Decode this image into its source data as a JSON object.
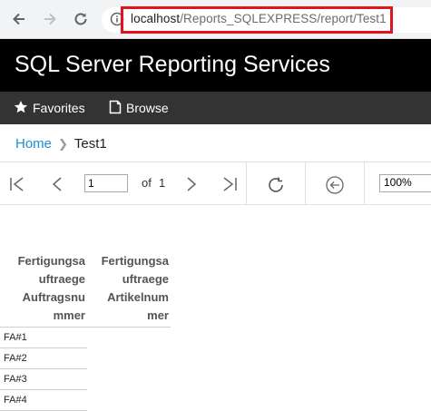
{
  "browser": {
    "url_host": "localhost",
    "url_path": "/Reports_SQLEXPRESS/report/Test1"
  },
  "header": {
    "app_title": "SQL Server Reporting Services"
  },
  "toolbar": {
    "favorites_label": "Favorites",
    "browse_label": "Browse"
  },
  "breadcrumb": {
    "home": "Home",
    "current": "Test1"
  },
  "report_toolbar": {
    "current_page": "1",
    "of_label": "of",
    "total_pages": "1",
    "zoom": "100%"
  },
  "report": {
    "columns": [
      [
        "Fertigungsa",
        "uftraege",
        "Auftragsnu",
        "mmer"
      ],
      [
        "Fertigungsa",
        "uftraege",
        "Artikelnum",
        "mer"
      ]
    ],
    "rows": [
      [
        "FA#1",
        ""
      ],
      [
        "FA#2",
        ""
      ],
      [
        "FA#3",
        ""
      ],
      [
        "FA#4",
        ""
      ]
    ]
  },
  "colors": {
    "title_bar": "#000000",
    "toolbar": "#333333",
    "link": "#1a8cd8",
    "url_highlight": "#e0141e"
  }
}
